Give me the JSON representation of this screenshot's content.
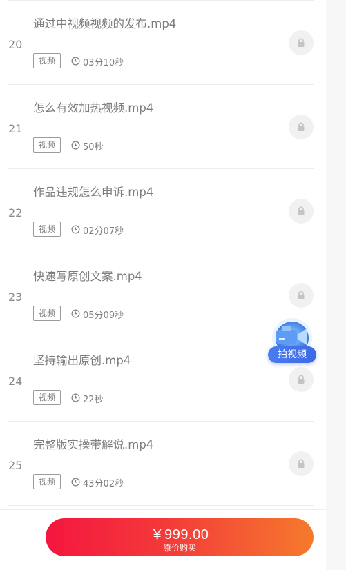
{
  "course_list": {
    "items": [
      {
        "index": "20",
        "title": "通过中视频视频的发布.mp4",
        "type": "视频",
        "duration": "03分10秒"
      },
      {
        "index": "21",
        "title": "怎么有效加热视频.mp4",
        "type": "视频",
        "duration": "50秒"
      },
      {
        "index": "22",
        "title": "作品违规怎么申诉.mp4",
        "type": "视频",
        "duration": "02分07秒"
      },
      {
        "index": "23",
        "title": "快速写原创文案.mp4",
        "type": "视频",
        "duration": "05分09秒"
      },
      {
        "index": "24",
        "title": "坚持输出原创.mp4",
        "type": "视频",
        "duration": "22秒"
      },
      {
        "index": "25",
        "title": "完整版实操带解说.mp4",
        "type": "视频",
        "duration": "43分02秒"
      }
    ]
  },
  "floating_button": {
    "label": "拍视频",
    "icon": "video-camera-icon",
    "color": "#3b6ae6"
  },
  "purchase": {
    "price": "￥999.00",
    "label": "原价购买",
    "accent_start": "#f5163f",
    "accent_end": "#f57a2c"
  }
}
